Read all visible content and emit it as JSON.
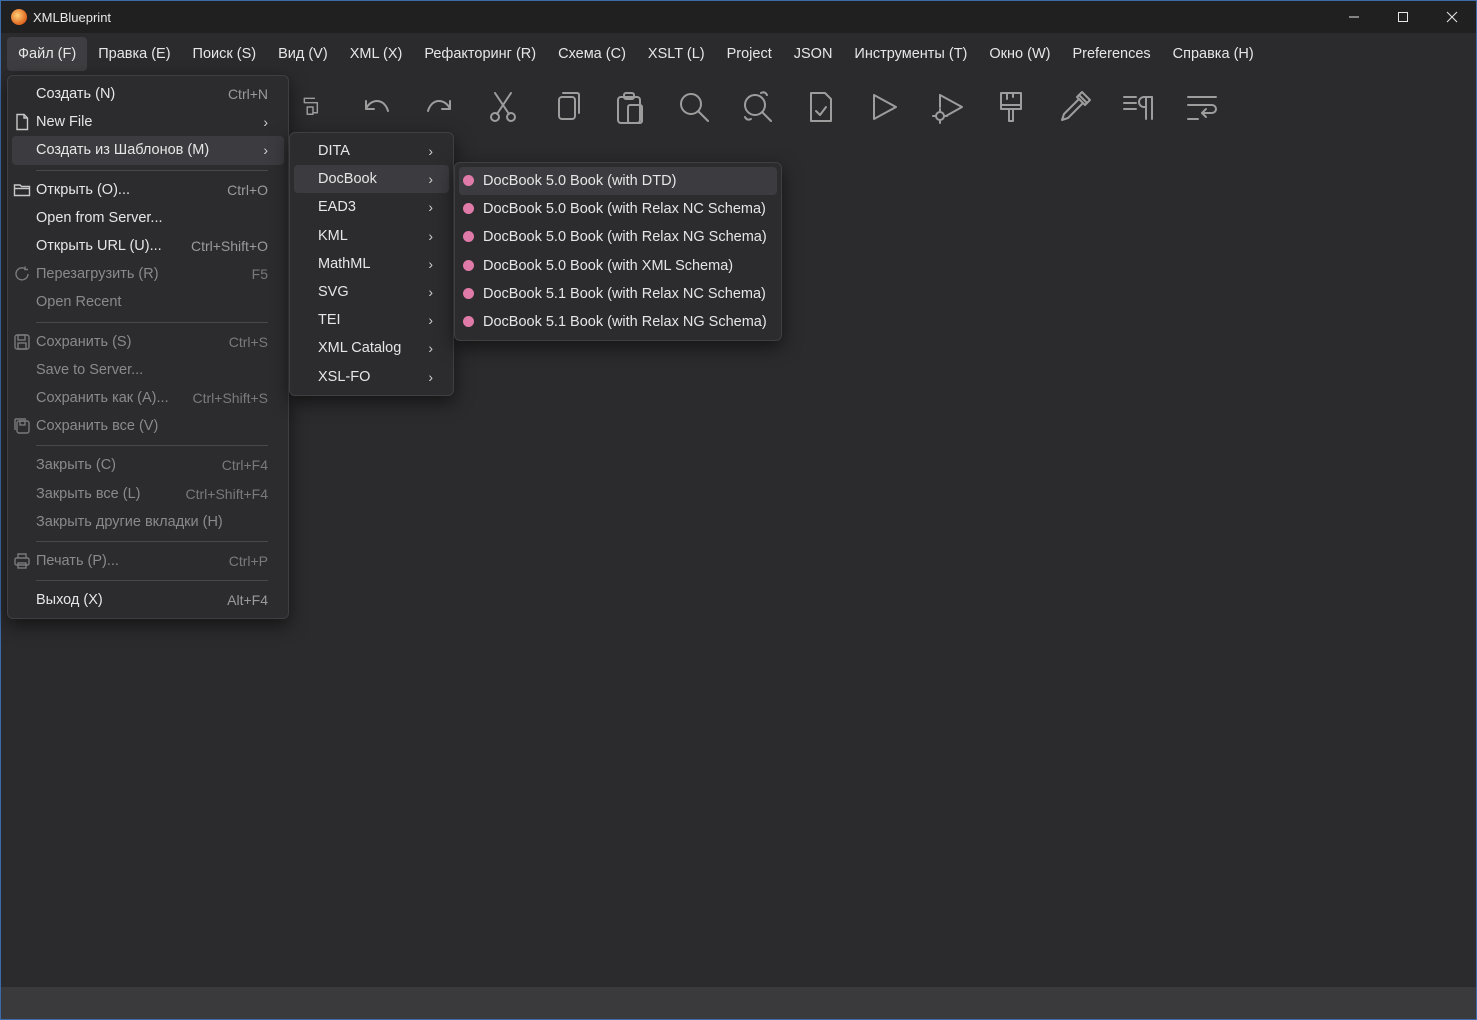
{
  "window": {
    "title": "XMLBlueprint",
    "accent": "#3d6aa8",
    "controls": [
      "minimize",
      "maximize",
      "close"
    ]
  },
  "menubar": [
    "Файл (F)",
    "Правка (E)",
    "Поиск (S)",
    "Вид (V)",
    "XML (X)",
    "Рефакторинг (R)",
    "Схема (C)",
    "XSLT (L)",
    "Project",
    "JSON",
    "Инструменты (T)",
    "Окно (W)",
    "Preferences",
    "Справка (H)"
  ],
  "toolbar_icons": [
    "print-icon",
    "undo-icon",
    "redo-icon",
    "cut-icon",
    "copy-icon",
    "paste-icon",
    "search-icon",
    "replace-icon",
    "validate-icon",
    "run-icon",
    "run-settings-icon",
    "brush-icon",
    "eyedropper-icon",
    "format-icon",
    "wrap-icon"
  ],
  "file_menu": [
    {
      "label": "Создать (N)",
      "shortcut": "Ctrl+N",
      "disabled": false
    },
    {
      "label": "New File",
      "submenu": true,
      "icon": "new-file-icon",
      "disabled": false
    },
    {
      "label": "Создать из Шаблонов (M)",
      "submenu": true,
      "highlighted": true,
      "disabled": false
    },
    {
      "separator": true
    },
    {
      "label": "Открыть (O)...",
      "shortcut": "Ctrl+O",
      "icon": "folder-icon",
      "disabled": false
    },
    {
      "label": "Open from Server...",
      "disabled": false
    },
    {
      "label": "Открыть URL (U)...",
      "shortcut": "Ctrl+Shift+O",
      "disabled": false
    },
    {
      "label": "Перезагрузить (R)",
      "shortcut": "F5",
      "icon": "reload-icon",
      "disabled": true
    },
    {
      "label": "Open Recent",
      "disabled": true
    },
    {
      "separator": true
    },
    {
      "label": "Сохранить (S)",
      "shortcut": "Ctrl+S",
      "icon": "save-icon",
      "disabled": true
    },
    {
      "label": "Save to Server...",
      "disabled": true
    },
    {
      "label": "Сохранить как (A)...",
      "shortcut": "Ctrl+Shift+S",
      "disabled": true
    },
    {
      "label": "Сохранить все (V)",
      "icon": "save-all-icon",
      "disabled": true
    },
    {
      "separator": true
    },
    {
      "label": "Закрыть (C)",
      "shortcut": "Ctrl+F4",
      "disabled": true
    },
    {
      "label": "Закрыть все (L)",
      "shortcut": "Ctrl+Shift+F4",
      "disabled": true
    },
    {
      "label": "Закрыть другие вкладки (H)",
      "disabled": true
    },
    {
      "separator": true
    },
    {
      "label": "Печать (P)...",
      "shortcut": "Ctrl+P",
      "icon": "print-icon",
      "disabled": true
    },
    {
      "separator": true
    },
    {
      "label": "Выход (X)",
      "shortcut": "Alt+F4",
      "disabled": false
    }
  ],
  "template_menu": [
    {
      "label": "DITA"
    },
    {
      "label": "DocBook",
      "highlighted": true
    },
    {
      "label": "EAD3"
    },
    {
      "label": "KML"
    },
    {
      "label": "MathML"
    },
    {
      "label": "SVG"
    },
    {
      "label": "TEI"
    },
    {
      "label": "XML Catalog"
    },
    {
      "label": "XSL-FO"
    }
  ],
  "docbook_menu": [
    {
      "label": "DocBook 5.0 Book (with DTD)",
      "highlighted": true
    },
    {
      "label": "DocBook 5.0 Book (with Relax NC Schema)"
    },
    {
      "label": "DocBook 5.0 Book (with Relax NG Schema)"
    },
    {
      "label": "DocBook 5.0 Book (with XML Schema)"
    },
    {
      "label": "DocBook 5.1 Book (with Relax NC Schema)"
    },
    {
      "label": "DocBook 5.1 Book (with Relax NG Schema)"
    }
  ],
  "colors": {
    "background": "#2b2b2d",
    "menu_bg": "#2c2c2e",
    "highlight": "#3c3c40",
    "bullet": "#e07aa8"
  }
}
